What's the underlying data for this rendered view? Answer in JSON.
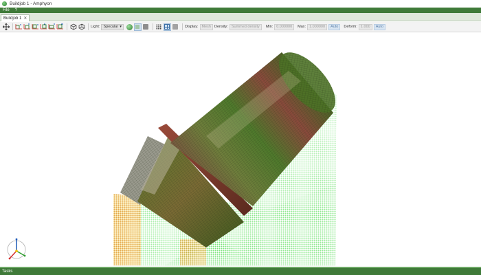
{
  "window": {
    "title": "Buildjob 1 - Amphyon"
  },
  "menu": {
    "items": [
      "File",
      "?"
    ]
  },
  "tabs": [
    {
      "label": "Buildjob 1",
      "close": "✕"
    }
  ],
  "toolbar": {
    "light_label": "Light:",
    "light_value": "Specular",
    "display_label": "Display:",
    "display_value": "Mesh",
    "density_label": "Density:",
    "density_value": "Summed density",
    "min_label": "Min:",
    "min_value": "0.000000",
    "max_label": "Max:",
    "max_value": "1.000000",
    "max_auto": "Auto",
    "deform_label": "Deform:",
    "deform_value": "1.000",
    "deform_auto": "Auto",
    "icons": [
      "fit-view-icon",
      "view-front-icon",
      "view-back-icon",
      "view-left-icon",
      "view-right-icon",
      "view-top-icon",
      "view-iso-icon",
      "view-iso-alt-icon",
      "shading-sphere-icon",
      "light-rays-icon",
      "solid-square-icon",
      "points-grid-icon",
      "box-grid-icon",
      "flat-square-icon"
    ]
  },
  "statusbar": {
    "tasks_label": "Tasks"
  },
  "colors": {
    "brand_green": "#3f7a39",
    "tab_bg": "#dfe8dc",
    "auto_blue": "#5a7fa8"
  }
}
